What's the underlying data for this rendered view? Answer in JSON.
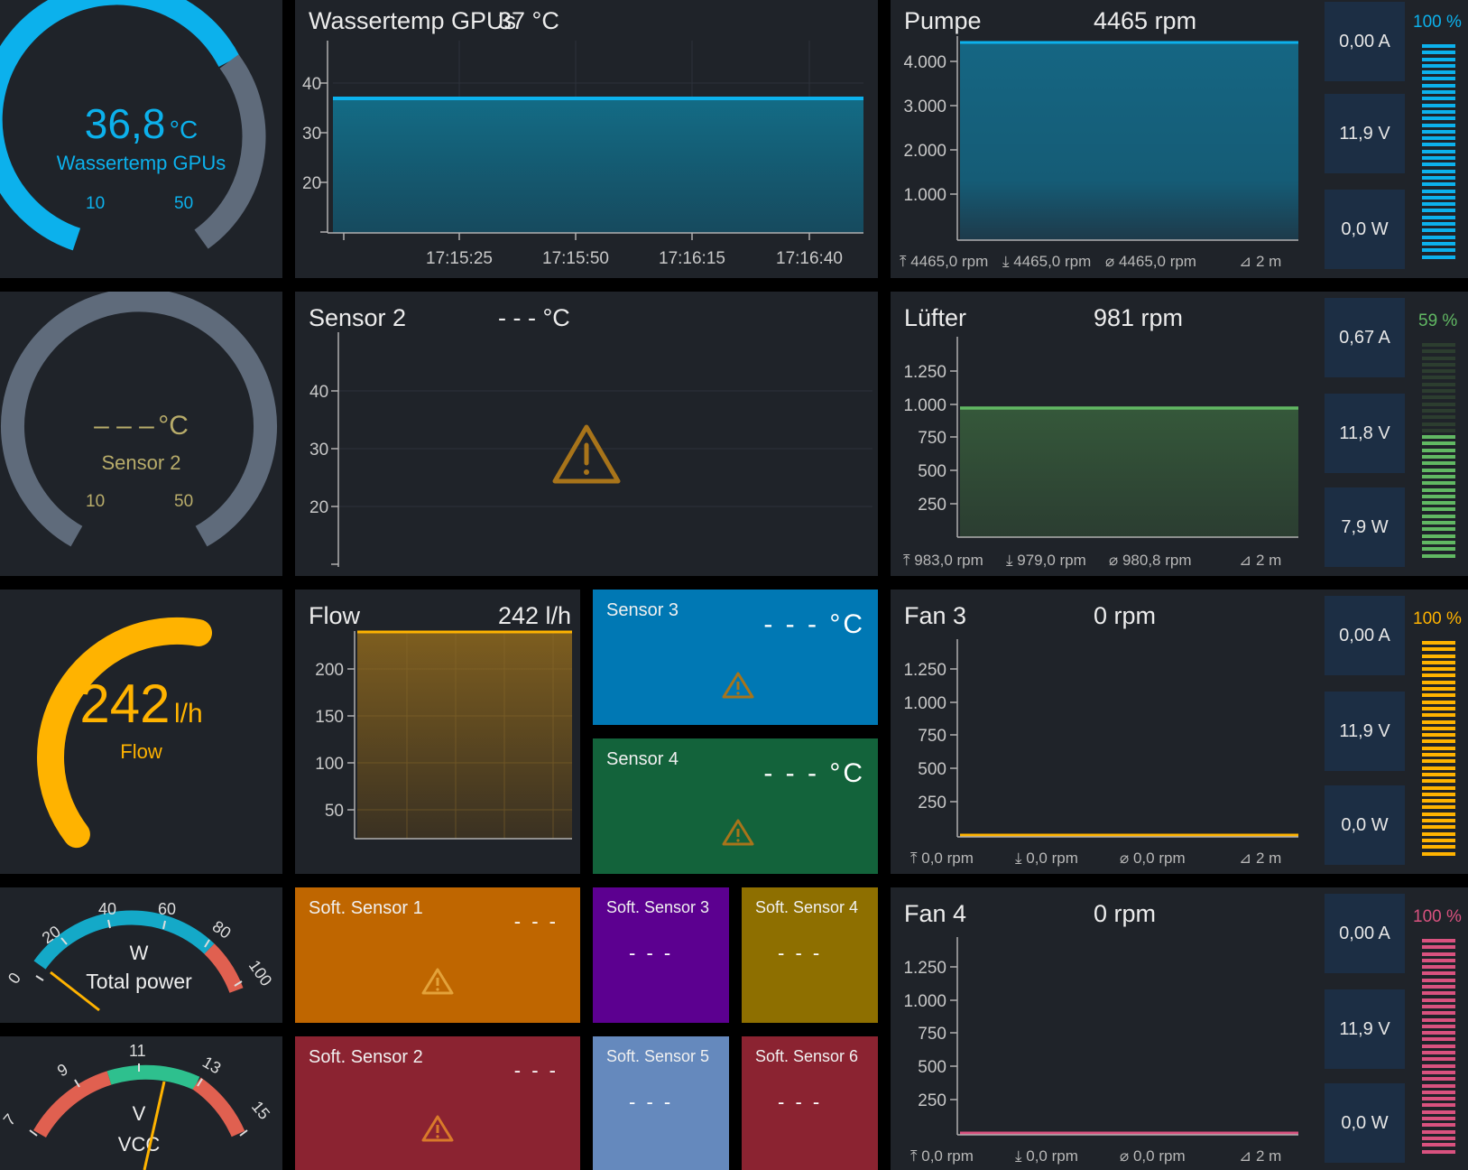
{
  "colors": {
    "blue": "#0cb1ec",
    "gray_arc": "#5f6b7b",
    "orange": "#ffb300",
    "green": "#61b863",
    "pink": "#d9527f",
    "warn": "#a8741a",
    "panel": "#1f2329",
    "cell": "#1c2e44"
  },
  "gauges": {
    "water": {
      "value": "36,8",
      "unit": "°C",
      "label": "Wassertemp GPUs",
      "min": "10",
      "max": "50",
      "level": 0.67
    },
    "sensor2": {
      "value": "– – –",
      "unit": "°C",
      "label": "Sensor 2",
      "min": "10",
      "max": "50"
    },
    "flow": {
      "value": "242",
      "unit": "l/h",
      "label": "Flow",
      "level": 0.6
    },
    "power": {
      "unit": "W",
      "label": "Total power",
      "ticks": [
        "0",
        "20",
        "40",
        "60",
        "80",
        "100"
      ],
      "value": 2
    },
    "vcc": {
      "unit": "V",
      "label": "VCC",
      "ticks": [
        "7",
        "9",
        "11",
        "13",
        "15"
      ],
      "value": 11.9
    }
  },
  "chart_water": {
    "title": "Wassertemp GPUs",
    "value": "37 °C",
    "yticks": [
      "40",
      "30",
      "20"
    ],
    "xticks": [
      "17:15:25",
      "17:15:50",
      "17:16:15",
      "17:16:40"
    ]
  },
  "chart_sensor2": {
    "title": "Sensor 2",
    "value": "- - - °C",
    "yticks": [
      "40",
      "30",
      "20"
    ]
  },
  "chart_flow": {
    "title": "Flow",
    "value": "242 l/h",
    "yticks": [
      "200",
      "150",
      "100",
      "50"
    ]
  },
  "fans": [
    {
      "name": "Pumpe",
      "rpm": "4465 rpm",
      "yticks": [
        "4.000",
        "3.000",
        "2.000",
        "1.000"
      ],
      "stats": {
        "max": "4465,0 rpm",
        "min": "4465,0 rpm",
        "avg": "4465,0 rpm",
        "span": "2 m"
      },
      "current": "0,00 A",
      "voltage": "11,9 V",
      "power": "0,0 W",
      "percent": "100 %",
      "duty": 1.0
    },
    {
      "name": "Lüfter",
      "rpm": "981 rpm",
      "yticks": [
        "1.250",
        "1.000",
        "750",
        "500",
        "250"
      ],
      "stats": {
        "max": "983,0 rpm",
        "min": "979,0 rpm",
        "avg": "980,8 rpm",
        "span": "2 m"
      },
      "current": "0,67 A",
      "voltage": "11,8 V",
      "power": "7,9 W",
      "percent": "59 %",
      "duty": 0.59
    },
    {
      "name": "Fan 3",
      "rpm": "0 rpm",
      "yticks": [
        "1.250",
        "1.000",
        "750",
        "500",
        "250"
      ],
      "stats": {
        "max": "0,0 rpm",
        "min": "0,0 rpm",
        "avg": "0,0 rpm",
        "span": "2 m"
      },
      "current": "0,00 A",
      "voltage": "11,9 V",
      "power": "0,0 W",
      "percent": "100 %",
      "duty": 1.0
    },
    {
      "name": "Fan 4",
      "rpm": "0 rpm",
      "yticks": [
        "1.250",
        "1.000",
        "750",
        "500",
        "250"
      ],
      "stats": {
        "max": "0,0 rpm",
        "min": "0,0 rpm",
        "avg": "0,0 rpm",
        "span": "2 m"
      },
      "current": "0,00 A",
      "voltage": "11,9 V",
      "power": "0,0 W",
      "percent": "100 %",
      "duty": 1.0
    }
  ],
  "tiles": {
    "sensor3": {
      "name": "Sensor 3",
      "value": "- - - °C"
    },
    "sensor4": {
      "name": "Sensor 4",
      "value": "- - - °C"
    },
    "soft1": {
      "name": "Soft. Sensor 1",
      "value": "- - -"
    },
    "soft2": {
      "name": "Soft. Sensor 2",
      "value": "- - -"
    },
    "soft3": {
      "name": "Soft. Sensor 3",
      "value": "- - -"
    },
    "soft4": {
      "name": "Soft. Sensor 4",
      "value": "- - -"
    },
    "soft5": {
      "name": "Soft. Sensor 5",
      "value": "- - -"
    },
    "soft6": {
      "name": "Soft. Sensor 6",
      "value": "- - -"
    }
  },
  "icons": {
    "warning": "warning-icon",
    "max": "arrow-up-icon",
    "min": "arrow-down-icon",
    "avg": "average-icon",
    "span": "timespan-icon"
  }
}
